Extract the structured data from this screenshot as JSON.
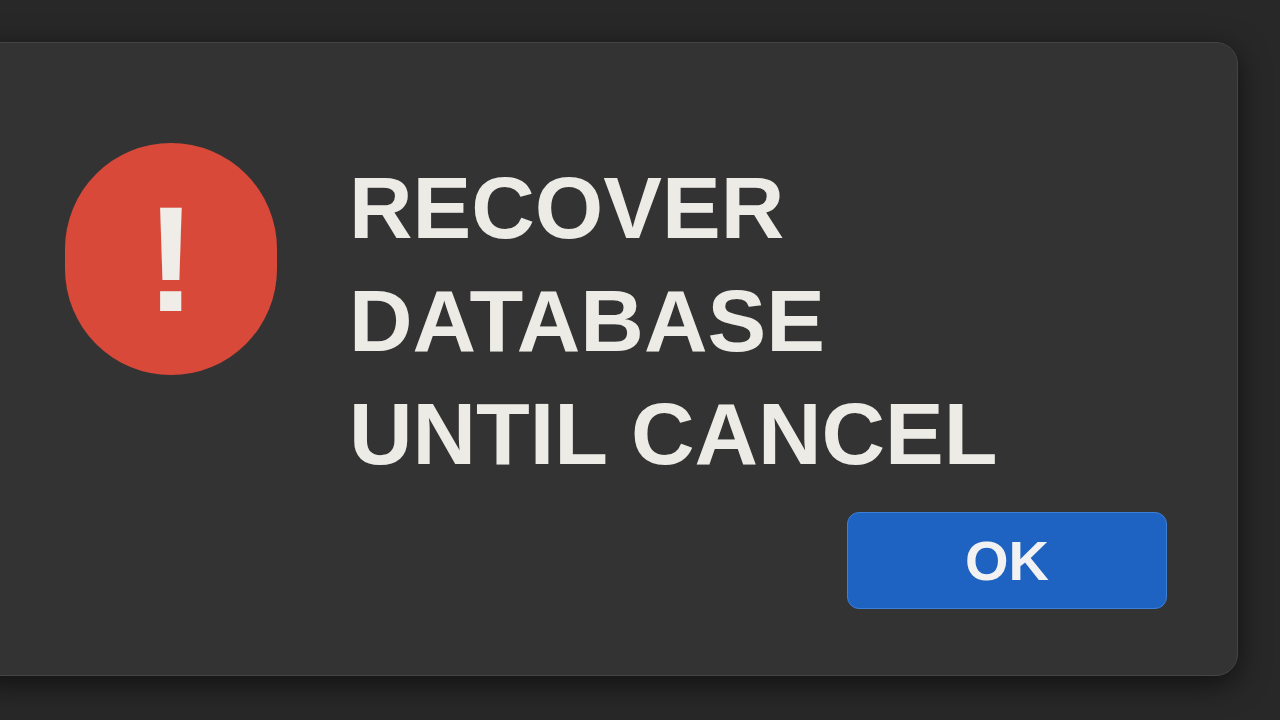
{
  "dialog": {
    "message": "RECOVER DATABASE UNTIL CANCEL",
    "icon_symbol": "!",
    "buttons": [
      {
        "label": "OK",
        "kind": "primary"
      }
    ]
  }
}
